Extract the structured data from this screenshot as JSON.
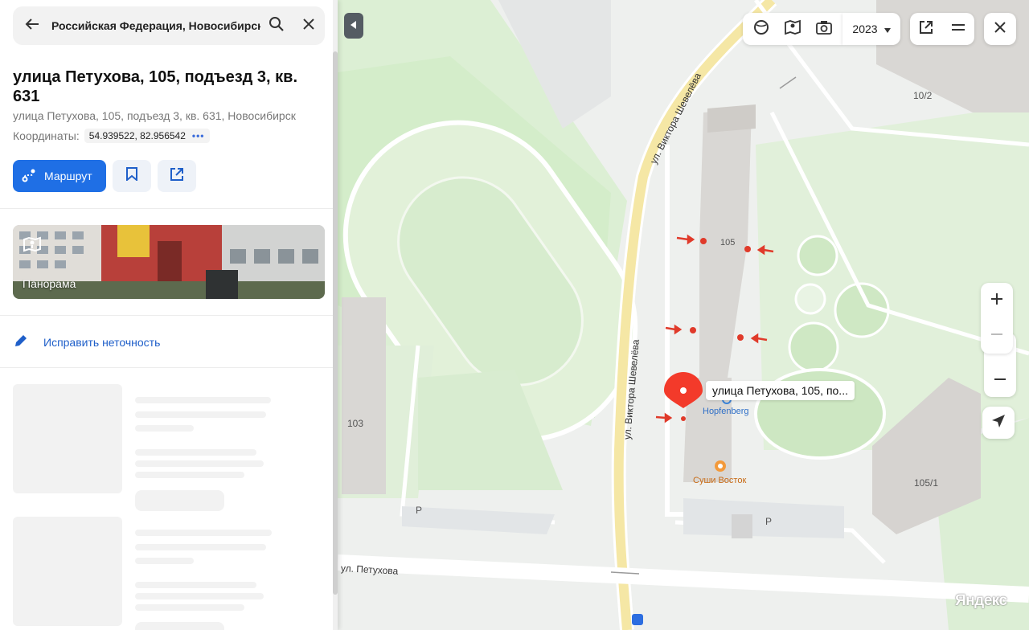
{
  "search": {
    "query": "Российская Федерация, Новосибирск"
  },
  "place": {
    "title": "улица Петухова, 105, подъезд 3, кв. 631",
    "subtitle": "улица Петухова, 105, подъезд 3, кв. 631, Новосибирск",
    "coords_label": "Координаты:",
    "coords_value": "54.939522, 82.956542",
    "coords_more": "•••"
  },
  "actions": {
    "route_label": "Маршрут"
  },
  "panorama": {
    "label": "Панорама"
  },
  "edit": {
    "label": "Исправить неточность"
  },
  "map": {
    "year": "2023",
    "pin_label": "улица Петухова, 105, по...",
    "building_labels": [
      "10/2",
      "105",
      "103",
      "105/1"
    ],
    "street_labels": [
      "ул. Виктора Шевелёва",
      "ул. Виктора Шевелёва",
      "ул. Петухова"
    ],
    "poi": {
      "hopfenberg": "Hopfenberg",
      "sushi": "Суши Восток"
    },
    "parking_labels": [
      "P",
      "P"
    ],
    "logo": "Яндекс"
  },
  "colors": {
    "accent": "#1f6fe5",
    "pin": "#f33a2a",
    "green": "#c9e8bf",
    "road": "#f6e7a6",
    "edit_link": "#1f5fc9"
  }
}
